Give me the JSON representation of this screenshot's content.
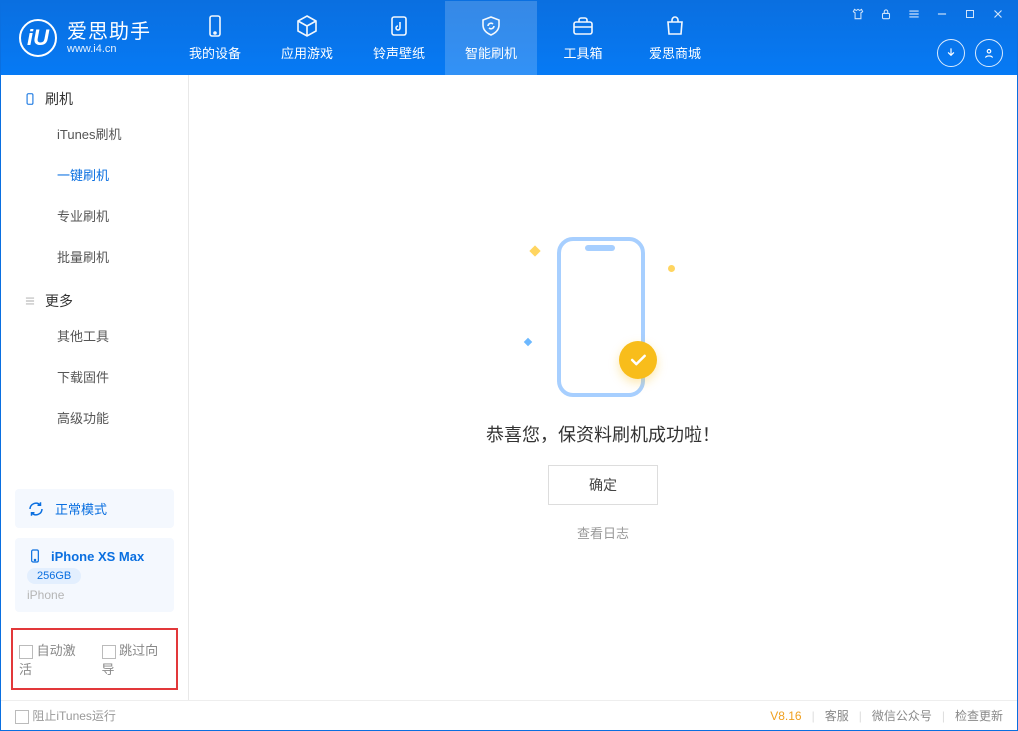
{
  "app": {
    "title": "爱思助手",
    "subtitle": "www.i4.cn",
    "logo_letter": "iU"
  },
  "nav": {
    "tabs": [
      {
        "label": "我的设备"
      },
      {
        "label": "应用游戏"
      },
      {
        "label": "铃声壁纸"
      },
      {
        "label": "智能刷机"
      },
      {
        "label": "工具箱"
      },
      {
        "label": "爱思商城"
      }
    ],
    "active_index": 3
  },
  "sidebar": {
    "group1": {
      "title": "刷机",
      "items": [
        "iTunes刷机",
        "一键刷机",
        "专业刷机",
        "批量刷机"
      ],
      "active_index": 1
    },
    "group2": {
      "title": "更多",
      "items": [
        "其他工具",
        "下载固件",
        "高级功能"
      ]
    },
    "mode": {
      "label": "正常模式"
    },
    "device": {
      "name": "iPhone XS Max",
      "storage": "256GB",
      "type": "iPhone"
    },
    "highlight": {
      "opt1": "自动激活",
      "opt2": "跳过向导"
    }
  },
  "main": {
    "success_text": "恭喜您，保资料刷机成功啦！",
    "ok_button": "确定",
    "view_log": "查看日志"
  },
  "footer": {
    "block_itunes": "阻止iTunes运行",
    "version": "V8.16",
    "links": [
      "客服",
      "微信公众号",
      "检查更新"
    ]
  }
}
